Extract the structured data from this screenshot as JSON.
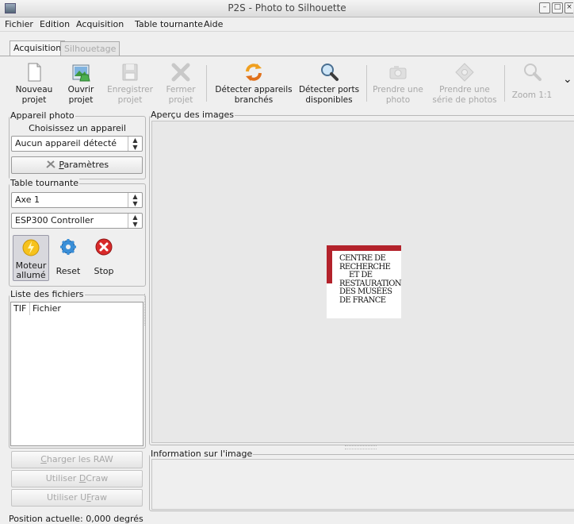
{
  "window": {
    "title": "P2S - Photo to Silhouette"
  },
  "menu": [
    "Fichier",
    "Edition",
    "Acquisition",
    "Table tournante",
    "Aide"
  ],
  "tabs": [
    {
      "label": "Acquisition",
      "active": true,
      "enabled": true
    },
    {
      "label": "Silhouetage",
      "active": false,
      "enabled": false
    }
  ],
  "toolbar": {
    "new": {
      "line1": "Nouveau",
      "line2": "projet",
      "icon": "new-document-icon"
    },
    "open": {
      "line1": "Ouvrir",
      "line2": "projet",
      "icon": "open-project-icon"
    },
    "save": {
      "line1": "Enregistrer",
      "line2": "projet",
      "icon": "save-icon"
    },
    "close": {
      "line1": "Fermer",
      "line2": "projet",
      "icon": "close-x-icon"
    },
    "detect_devices": {
      "line1": "Détecter appareils",
      "line2": "branchés",
      "icon": "refresh-arrows-icon"
    },
    "detect_ports": {
      "line1": "Détecter ports",
      "line2": "disponibles",
      "icon": "magnifier-icon"
    },
    "take_photo": {
      "line1": "Prendre une",
      "line2": "photo",
      "icon": "camera-icon"
    },
    "take_series": {
      "line1": "Prendre une",
      "line2": "série de photos",
      "icon": "camera-series-icon"
    },
    "zoom": {
      "label": "Zoom 1:1",
      "icon": "zoom-icon"
    },
    "overflow": "⌄"
  },
  "camera_group": {
    "title": "Appareil photo",
    "subtitle": "Choisissez un appareil",
    "selected_device": "Aucun appareil détecté",
    "settings_prefix": "",
    "settings_mnemonic": "P",
    "settings_rest": "aramètres"
  },
  "turntable_group": {
    "title": "Table tournante",
    "axis": "Axe 1",
    "controller": "ESP300 Controller",
    "motor_line1": "Moteur",
    "motor_line2": "allumé",
    "reset": "Reset",
    "stop": "Stop"
  },
  "files_group": {
    "title": "Liste des fichiers",
    "columns": [
      "TIF",
      "Fichier"
    ]
  },
  "buttons": {
    "load_raw_prefix": "",
    "load_raw_mnemonic": "C",
    "load_raw_rest": "harger les RAW",
    "dcraw_prefix": "Utiliser ",
    "dcraw_mnemonic": "D",
    "dcraw_rest": "Craw",
    "ufraw_prefix": "Utiliser U",
    "ufraw_mnemonic": "F",
    "ufraw_rest": "raw"
  },
  "preview": {
    "title": "Aperçu des images",
    "logo_lines": [
      "CENTRE DE",
      "RECHERCHE",
      "ET DE",
      "RESTAURATION",
      "DES MUSÉES",
      "DE FRANCE"
    ]
  },
  "info": {
    "title": "Information sur l'image"
  },
  "status": "Position actuelle: 0,000 degrés",
  "colors": {
    "logo_red": "#b3222b",
    "background": "#efefef"
  }
}
